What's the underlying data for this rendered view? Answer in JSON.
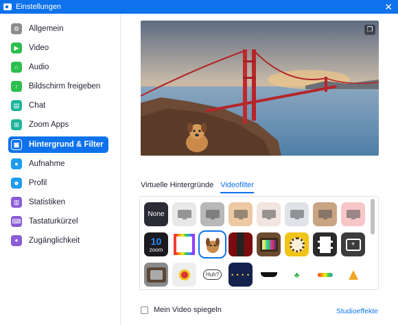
{
  "window": {
    "title": "Einstellungen",
    "close_glyph": "✕"
  },
  "sidebar": {
    "items": [
      {
        "label": "Allgemein",
        "icon": "gear-icon",
        "color": "#8c8c8c",
        "glyph": "⚙",
        "active": false
      },
      {
        "label": "Video",
        "icon": "video-icon",
        "color": "#2cbf4f",
        "glyph": "▶",
        "active": false
      },
      {
        "label": "Audio",
        "icon": "headphones-icon",
        "color": "#2cbf4f",
        "glyph": "∩",
        "active": false
      },
      {
        "label": "Bildschirm freigeben",
        "icon": "share-screen-icon",
        "color": "#2cbf4f",
        "glyph": "↑",
        "active": false
      },
      {
        "label": "Chat",
        "icon": "chat-icon",
        "color": "#1fb59b",
        "glyph": "▤",
        "active": false
      },
      {
        "label": "Zoom Apps",
        "icon": "apps-icon",
        "color": "#1fb59b",
        "glyph": "⊞",
        "active": false
      },
      {
        "label": "Hintergrund & Filter",
        "icon": "background-icon",
        "color": "#ffffff",
        "glyph": "▣",
        "active": true
      },
      {
        "label": "Aufnahme",
        "icon": "record-icon",
        "color": "#1f9cf0",
        "glyph": "●",
        "active": false
      },
      {
        "label": "Profil",
        "icon": "profile-icon",
        "color": "#1f9cf0",
        "glyph": "☻",
        "active": false
      },
      {
        "label": "Statistiken",
        "icon": "statistics-icon",
        "color": "#8a5cd6",
        "glyph": "▥",
        "active": false
      },
      {
        "label": "Tastaturkürzel",
        "icon": "keyboard-icon",
        "color": "#8a5cd6",
        "glyph": "⌨",
        "active": false
      },
      {
        "label": "Zugänglichkeit",
        "icon": "accessibility-icon",
        "color": "#8a5cd6",
        "glyph": "✦",
        "active": false
      }
    ]
  },
  "main": {
    "tabs": [
      {
        "label": "Virtuelle Hintergründe",
        "active": false
      },
      {
        "label": "Videofilter",
        "active": true
      }
    ],
    "filters": {
      "row1": [
        {
          "name": "filter-none",
          "label": "None",
          "bg": "#2b2b36",
          "fg": "#ffffff"
        },
        {
          "name": "filter-light-gray",
          "label": "",
          "bg": "#e8e8e8",
          "fg": ""
        },
        {
          "name": "filter-gray",
          "label": "",
          "bg": "#b8b8b8",
          "fg": ""
        },
        {
          "name": "filter-warm",
          "label": "",
          "bg": "#ecc9a2",
          "fg": ""
        },
        {
          "name": "filter-soft",
          "label": "",
          "bg": "#f2e4de",
          "fg": ""
        },
        {
          "name": "filter-cool",
          "label": "",
          "bg": "#dfe3e8",
          "fg": ""
        },
        {
          "name": "filter-sepia",
          "label": "",
          "bg": "#c9a483",
          "fg": ""
        },
        {
          "name": "filter-pink",
          "label": "",
          "bg": "#f7c6c9",
          "fg": ""
        }
      ],
      "row2": [
        {
          "name": "filter-zoom-10",
          "label": "10",
          "bg": "#1b1b1f",
          "fg": "#2d8cff"
        },
        {
          "name": "filter-rainbow-frame",
          "label": "",
          "bg": "#ffffff",
          "fg": ""
        },
        {
          "name": "filter-dog-frame",
          "label": "",
          "bg": "#ffffff",
          "fg": ""
        },
        {
          "name": "filter-theater",
          "label": "",
          "bg": "#9d1518",
          "fg": ""
        },
        {
          "name": "filter-retro-tv",
          "label": "",
          "bg": "#6b4a2e",
          "fg": ""
        },
        {
          "name": "filter-sunflower",
          "label": "",
          "bg": "#f0c419",
          "fg": ""
        },
        {
          "name": "filter-film",
          "label": "",
          "bg": "#2b2b2b",
          "fg": ""
        },
        {
          "name": "filter-focus",
          "label": "",
          "bg": "#3c3c3c",
          "fg": ""
        }
      ],
      "row3": [
        {
          "name": "filter-old-tv",
          "label": "",
          "bg": "#8a8a8a",
          "fg": ""
        },
        {
          "name": "filter-award",
          "label": "",
          "bg": "#eeeeee",
          "fg": ""
        },
        {
          "name": "filter-huh-bubble",
          "label": "Huh?",
          "bg": "#ffffff",
          "fg": "#333333"
        },
        {
          "name": "filter-string-lights",
          "label": "",
          "bg": "#14224d",
          "fg": ""
        },
        {
          "name": "filter-sunglasses",
          "label": "",
          "bg": "#ffffff",
          "fg": ""
        },
        {
          "name": "filter-sprout",
          "label": "",
          "bg": "#ffffff",
          "fg": ""
        },
        {
          "name": "filter-rainbow",
          "label": "",
          "bg": "#ffffff",
          "fg": ""
        },
        {
          "name": "filter-party-hat",
          "label": "",
          "bg": "#ffffff",
          "fg": ""
        }
      ]
    },
    "zoom_small_text": "zoom",
    "mirror_label": "Mein Video spiegeln",
    "studio_label": "Studioeffekte"
  }
}
